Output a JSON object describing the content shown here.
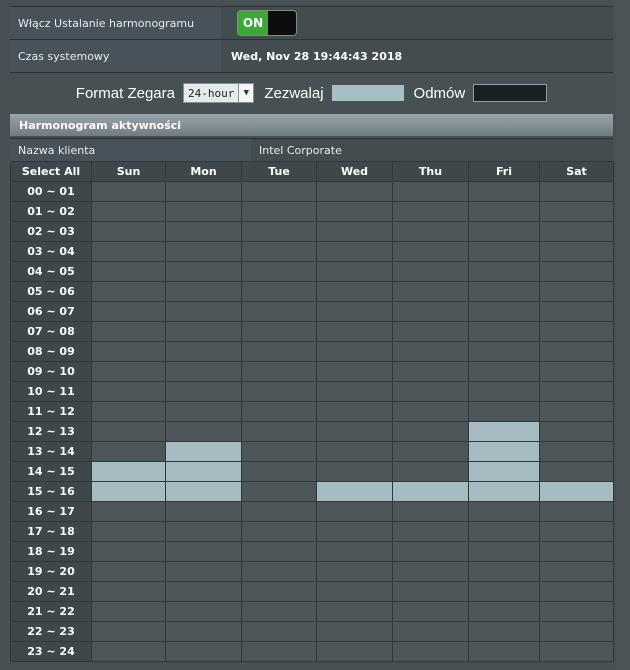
{
  "enable_schedule": {
    "label": "Włącz Ustalanie harmonogramu",
    "toggle_text": "ON"
  },
  "system_time": {
    "label": "Czas systemowy",
    "value": "Wed, Nov 28 19:44:43 2018"
  },
  "format": {
    "clock_label": "Format Zegara",
    "clock_value": "24-hour",
    "allow_label": "Zezwalaj",
    "deny_label": "Odmów"
  },
  "schedule": {
    "title": "Harmonogram aktywności",
    "client_label": "Nazwa klienta",
    "client_value": "Intel Corporate",
    "select_all": "Select All",
    "days": [
      "Sun",
      "Mon",
      "Tue",
      "Wed",
      "Thu",
      "Fri",
      "Sat"
    ],
    "hours": [
      "00 ~ 01",
      "01 ~ 02",
      "02 ~ 03",
      "03 ~ 04",
      "04 ~ 05",
      "05 ~ 06",
      "06 ~ 07",
      "07 ~ 08",
      "08 ~ 09",
      "09 ~ 10",
      "10 ~ 11",
      "11 ~ 12",
      "12 ~ 13",
      "13 ~ 14",
      "14 ~ 15",
      "15 ~ 16",
      "16 ~ 17",
      "17 ~ 18",
      "18 ~ 19",
      "19 ~ 20",
      "20 ~ 21",
      "21 ~ 22",
      "22 ~ 23",
      "23 ~ 24"
    ],
    "allowed": {
      "Sun": [
        "14 ~ 15",
        "15 ~ 16"
      ],
      "Mon": [
        "13 ~ 14",
        "14 ~ 15",
        "15 ~ 16"
      ],
      "Tue": [],
      "Wed": [
        "15 ~ 16"
      ],
      "Thu": [
        "15 ~ 16"
      ],
      "Fri": [
        "12 ~ 13",
        "13 ~ 14",
        "14 ~ 15",
        "15 ~ 16"
      ],
      "Sat": [
        "15 ~ 16"
      ]
    }
  },
  "colors": {
    "allowed": "#a6bcc2",
    "denied": "#4d575a",
    "toggle_on": "#3aaa35"
  }
}
